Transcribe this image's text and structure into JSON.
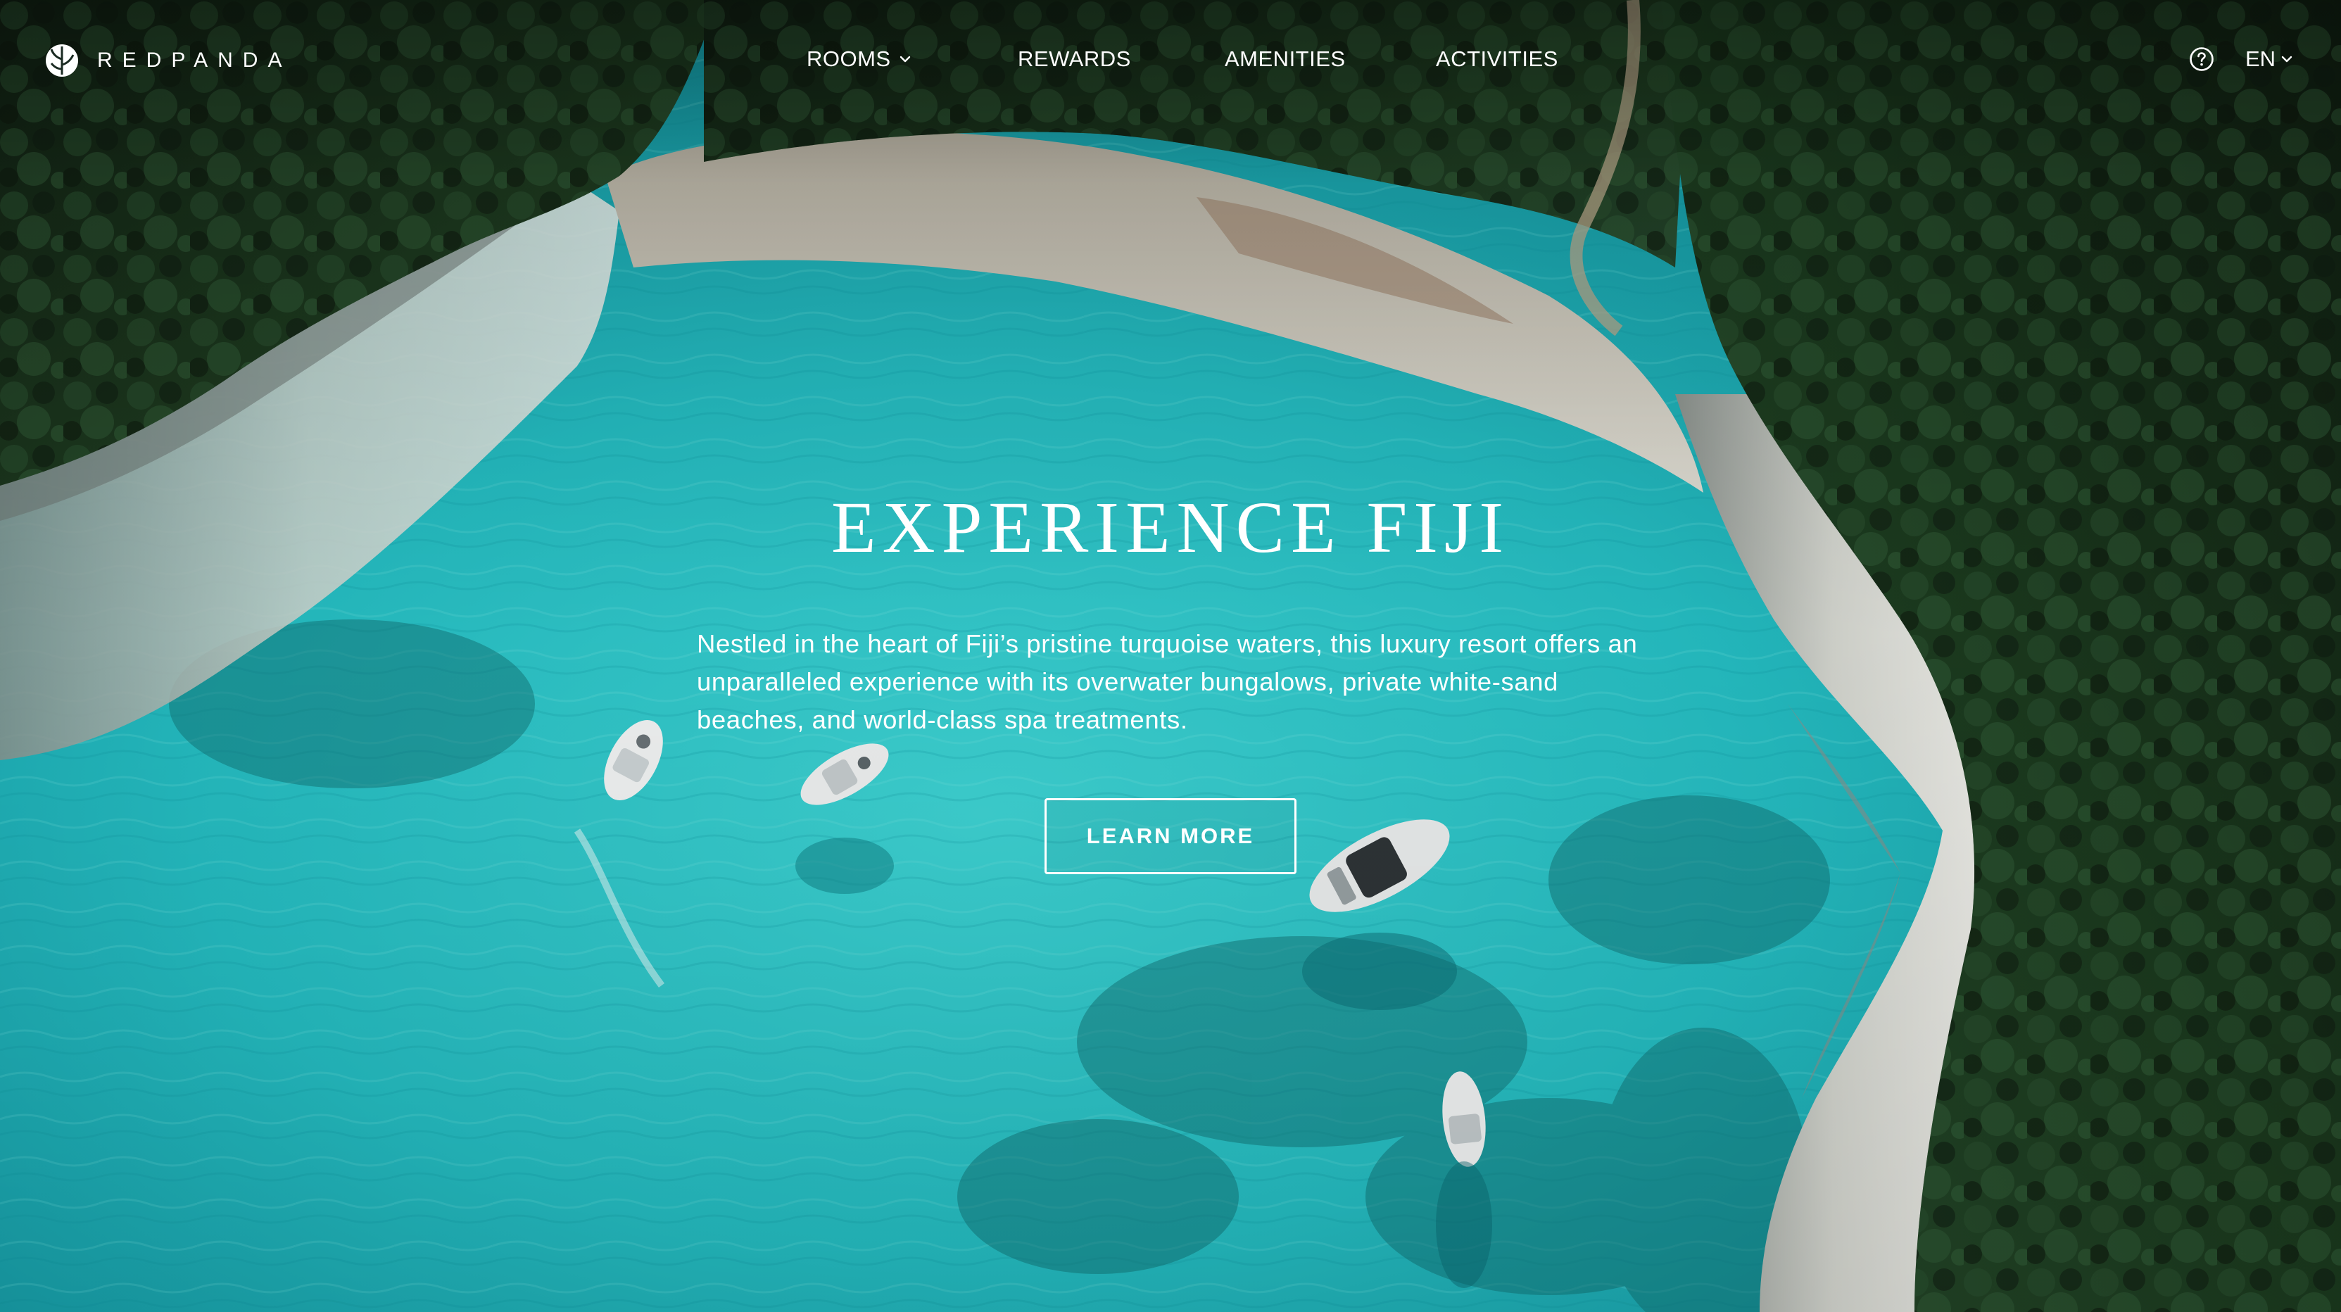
{
  "brand": {
    "name": "REDPANDA",
    "logo_icon": "leaf-circle-logo"
  },
  "nav": {
    "items": [
      {
        "label": "ROOMS",
        "has_dropdown": true
      },
      {
        "label": "REWARDS",
        "has_dropdown": false
      },
      {
        "label": "AMENITIES",
        "has_dropdown": false
      },
      {
        "label": "ACTIVITIES",
        "has_dropdown": false
      }
    ],
    "help_icon": "question-circle-icon",
    "language": {
      "selected": "EN",
      "icon": "chevron-down-icon"
    }
  },
  "hero": {
    "title": "EXPERIENCE FIJI",
    "description": "Nestled in the heart of Fiji’s pristine turquoise waters, this luxury resort offers an unparalleled experience with its overwater bungalows, private white-sand beaches, and world-class spa treatments.",
    "cta_label": "LEARN MORE",
    "background": "aerial photo of a turquoise bay with boats, rocky white cliffs and dense green forest"
  },
  "colors": {
    "text": "#ffffff",
    "water": "#1fb6bd",
    "forest": "#16301b",
    "rock": "#cfd2cc"
  }
}
